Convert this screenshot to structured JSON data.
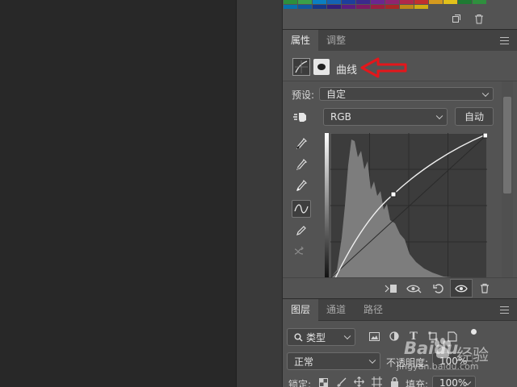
{
  "swatch_colors": [
    "#2d8f3c",
    "#3aa04a",
    "#0a7fc2",
    "#1463b4",
    "#1d3f9c",
    "#3b2a8c",
    "#6a2790",
    "#8f2470",
    "#b0284a",
    "#c0302e",
    "#d59a1f",
    "#e3c11a",
    "#1f7a33",
    "#2f8f3e",
    "#0670ad",
    "#10579f",
    "#16378a",
    "#321f7b",
    "#5b1d80",
    "#7c1a63",
    "#9c1f40",
    "#a92725",
    "#bd8718",
    "#cfad12"
  ],
  "accent_colors": {
    "annotation_arrow": "#e4161b"
  },
  "properties_panel": {
    "tabs": [
      "属性",
      "调整"
    ],
    "adjustment_name": "曲线",
    "preset_label": "预设:",
    "preset_value": "自定",
    "channel_value": "RGB",
    "auto_button": "自动"
  },
  "layers_panel": {
    "tabs": [
      "图层",
      "通道",
      "路径"
    ],
    "filter_value": "类型",
    "blend_mode": "正常",
    "opacity_label": "不透明度:",
    "opacity_value": "100%",
    "lock_label": "锁定:",
    "fill_label": "填充:",
    "fill_value": "100%"
  },
  "watermark": {
    "brand": "Baidu",
    "suffix": "经验",
    "url": "jingyan.baidu.com"
  }
}
